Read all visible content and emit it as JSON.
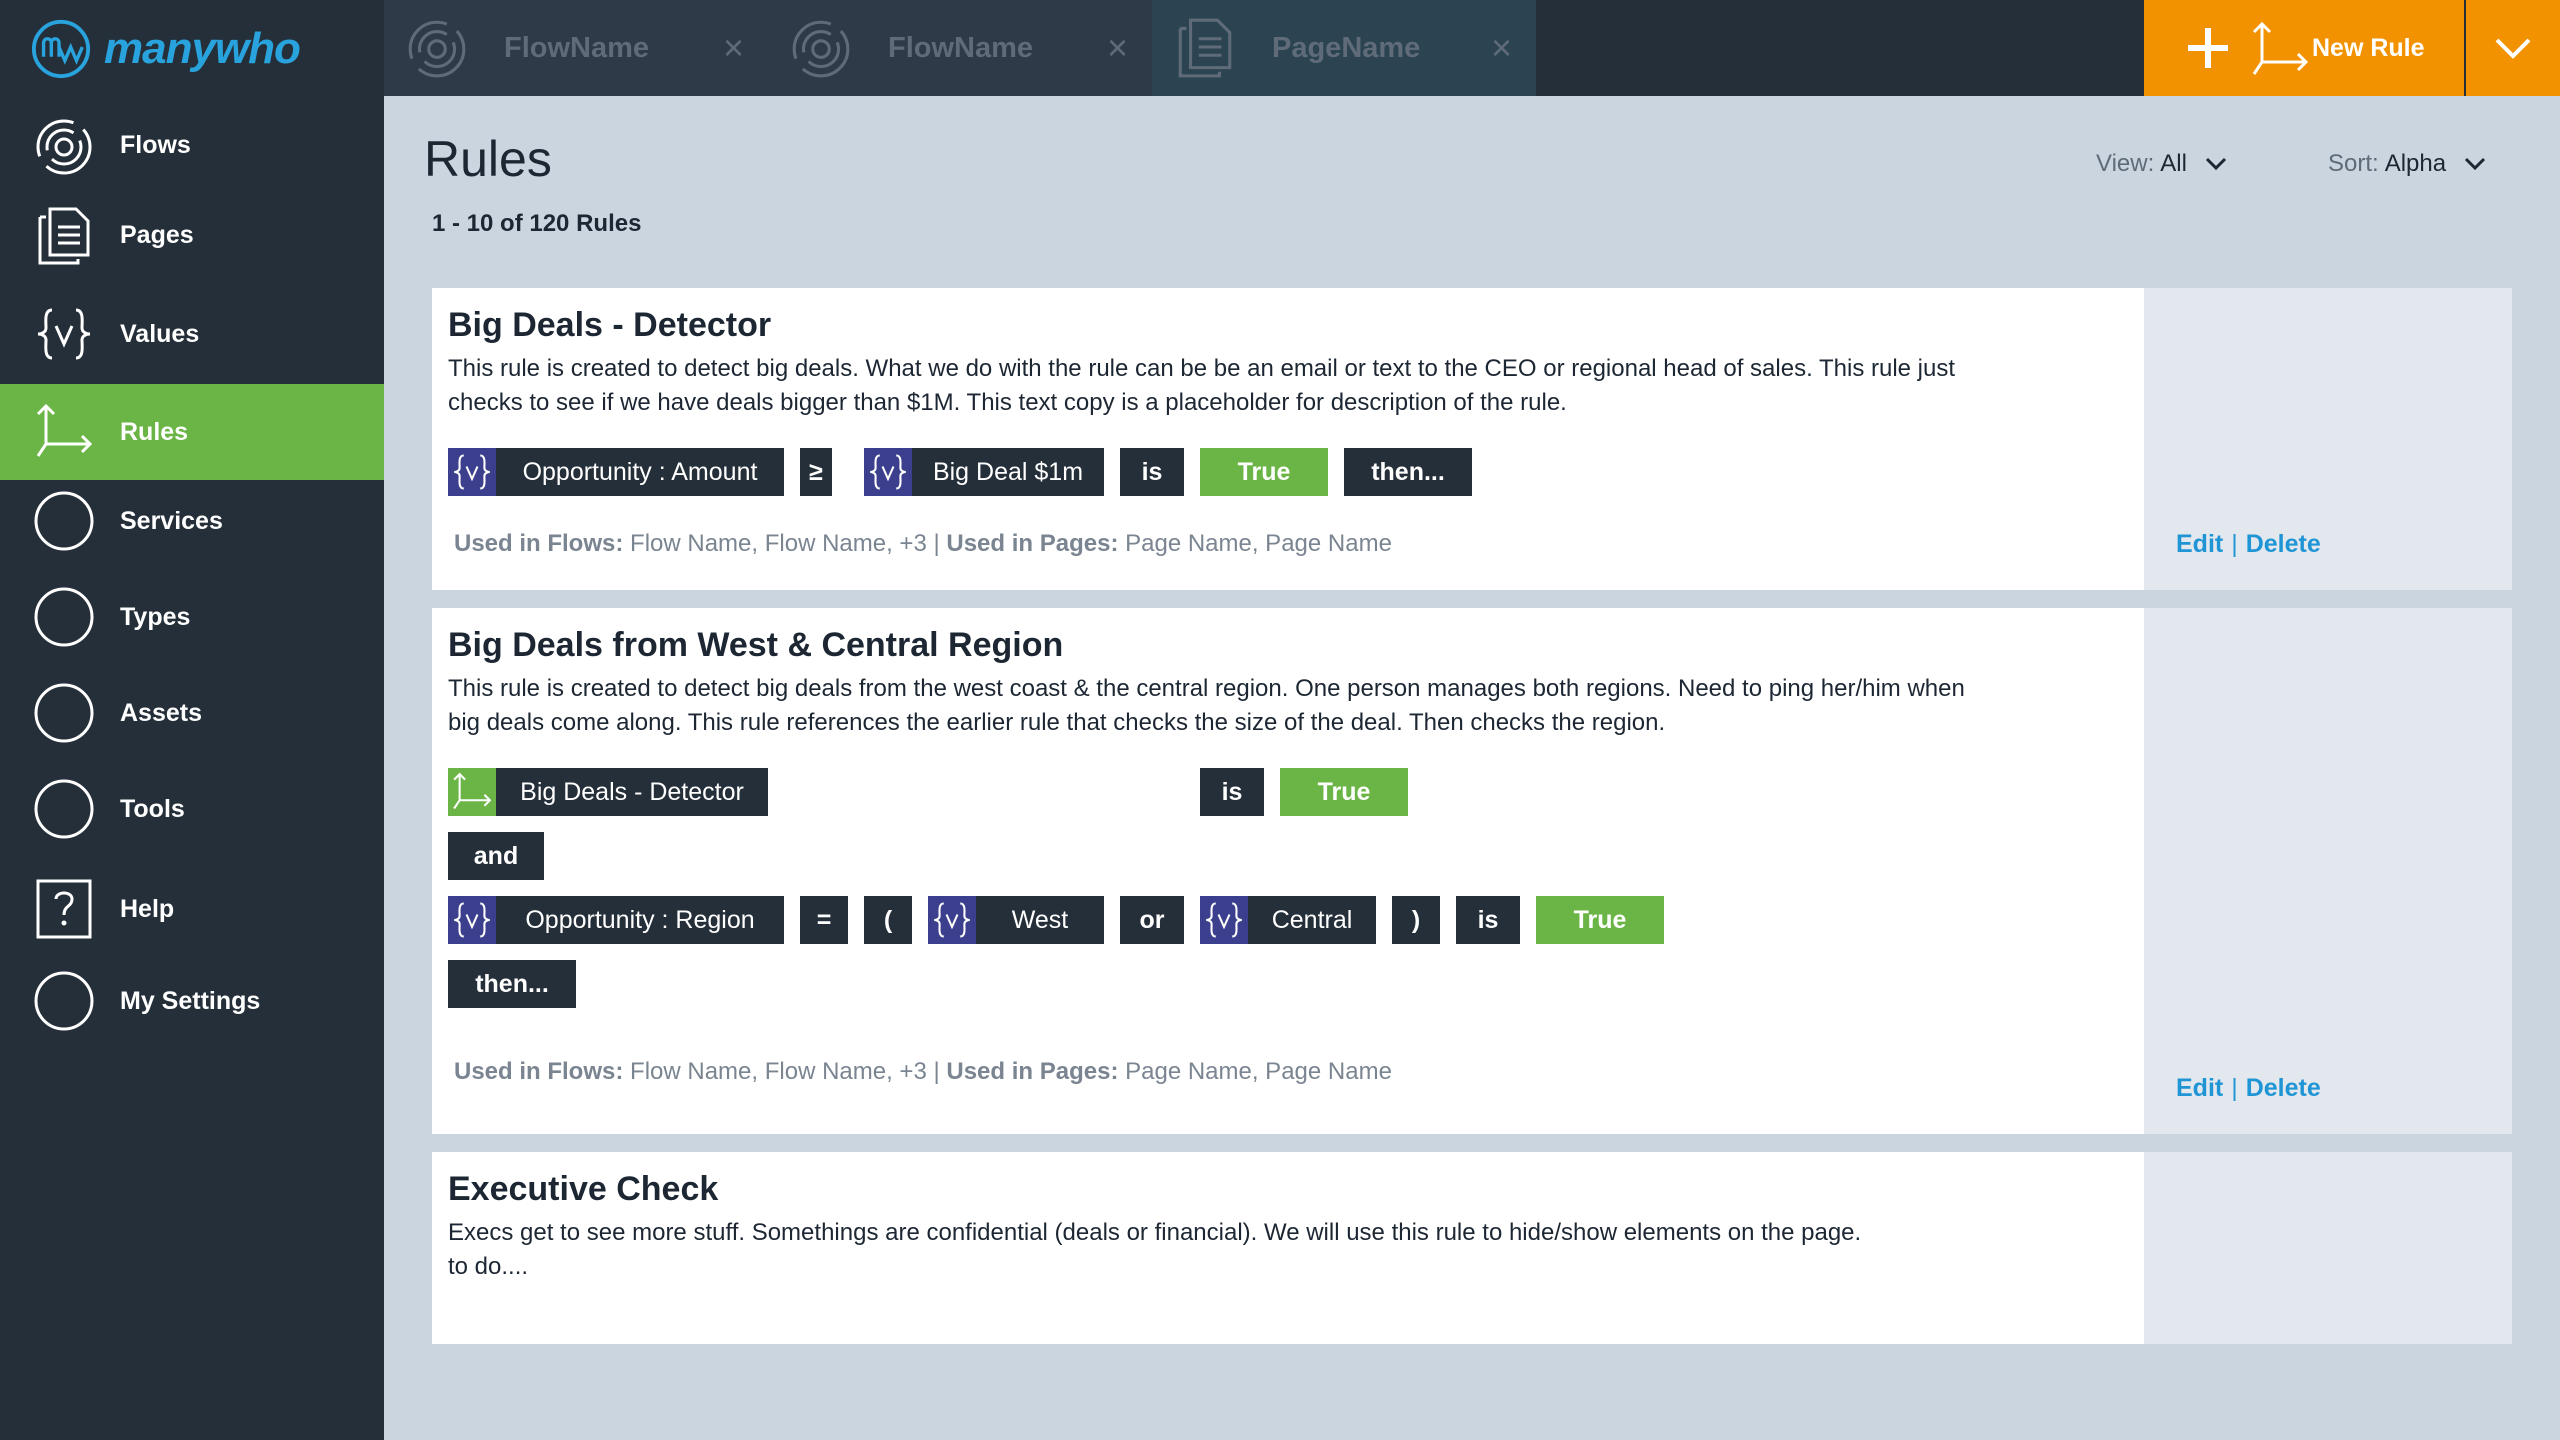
{
  "app": {
    "logo_text": "manywho"
  },
  "sidebar": {
    "items": [
      {
        "label": "Flows",
        "icon": "flow-icon"
      },
      {
        "label": "Pages",
        "icon": "page-icon"
      },
      {
        "label": "Values",
        "icon": "value-icon"
      },
      {
        "label": "Rules",
        "icon": "rule-icon",
        "active": true
      },
      {
        "label": "Services",
        "icon": "circle-icon"
      },
      {
        "label": "Types",
        "icon": "circle-icon"
      },
      {
        "label": "Assets",
        "icon": "circle-icon"
      },
      {
        "label": "Tools",
        "icon": "circle-icon"
      },
      {
        "label": "Help",
        "icon": "help-icon"
      },
      {
        "label": "My Settings",
        "icon": "circle-icon"
      }
    ]
  },
  "tabs": [
    {
      "label": "FlowName",
      "icon": "flow-icon",
      "close": "×"
    },
    {
      "label": "FlowName",
      "icon": "flow-icon",
      "close": "×"
    },
    {
      "label": "PageName",
      "icon": "page-icon",
      "close": "×",
      "active": true
    }
  ],
  "toolbar": {
    "new_rule_label": "New Rule"
  },
  "header": {
    "title": "Rules",
    "count": "1 - 10 of 120 Rules",
    "view_label": "View:",
    "view_value": "All",
    "sort_label": "Sort:",
    "sort_value": "Alpha"
  },
  "rules": [
    {
      "title": "Big Deals - Detector",
      "desc_line1": "This rule is created to detect big deals. What we do with the rule can be be an email or text to the CEO or regional head of sales. This rule just",
      "desc_line2": "checks to see if we have deals bigger than $1M. This text copy is a placeholder for description of the rule.",
      "chips": [
        "Opportunity : Amount",
        "≥",
        "Big Deal $1m",
        "is",
        "True",
        "then..."
      ],
      "used_flows_label": "Used in Flows:",
      "used_flows": "Flow Name, Flow Name, +3",
      "sep": "|",
      "used_pages_label": "Used in Pages:",
      "used_pages": "Page Name, Page Name",
      "edit": "Edit",
      "delete": "Delete"
    },
    {
      "title": "Big Deals from West & Central Region",
      "desc_line1": "This rule is created to detect big deals from the west coast & the central region. One person manages both regions. Need to ping her/him when",
      "desc_line2": "big deals come along. This rule references the earlier rule that checks the size of the deal. Then checks the region.",
      "chips_row1": [
        "Big Deals - Detector",
        "is",
        "True"
      ],
      "and": "and",
      "chips_row3": [
        "Opportunity : Region",
        "=",
        "(",
        "West",
        "or",
        "Central",
        ")",
        "is",
        "True"
      ],
      "then": "then...",
      "used_flows_label": "Used in Flows:",
      "used_flows": "Flow Name, Flow Name, +3",
      "sep": "|",
      "used_pages_label": "Used in Pages:",
      "used_pages": "Page Name, Page Name",
      "edit": "Edit",
      "delete": "Delete"
    },
    {
      "title": "Executive Check",
      "desc_line1": "Execs get to see more stuff. Somethings are confidential (deals or financial). We will use this rule to hide/show elements on the page.",
      "desc_line2": "to do...."
    }
  ],
  "colors": {
    "sidebar_bg": "#252f39",
    "active_green": "#6bb446",
    "accent_orange": "#f39200",
    "value_purple": "#3c3f8e",
    "link_blue": "#1f95d6",
    "content_bg": "#cbd5df"
  }
}
